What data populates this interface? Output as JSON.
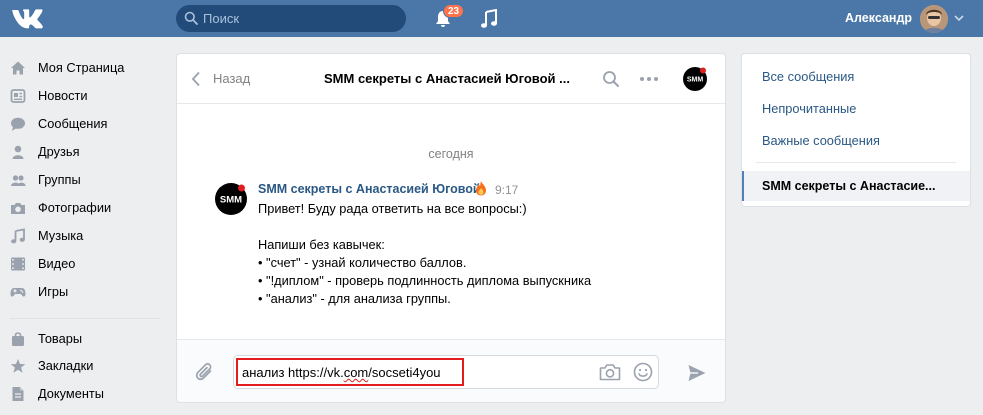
{
  "header": {
    "search_placeholder": "Поиск",
    "notification_count": "23",
    "user_name": "Александр"
  },
  "sidebar": {
    "items": [
      {
        "label": "Моя Страница",
        "icon": "home-icon"
      },
      {
        "label": "Новости",
        "icon": "news-icon"
      },
      {
        "label": "Сообщения",
        "icon": "messages-icon"
      },
      {
        "label": "Друзья",
        "icon": "friend-icon"
      },
      {
        "label": "Группы",
        "icon": "groups-icon"
      },
      {
        "label": "Фотографии",
        "icon": "camera-icon"
      },
      {
        "label": "Музыка",
        "icon": "music-note-icon"
      },
      {
        "label": "Видео",
        "icon": "video-icon"
      },
      {
        "label": "Игры",
        "icon": "gamepad-icon"
      },
      {
        "label": "Товары",
        "icon": "shopping-bag-icon"
      },
      {
        "label": "Закладки",
        "icon": "star-icon"
      },
      {
        "label": "Документы",
        "icon": "document-icon"
      }
    ]
  },
  "chat": {
    "back_label": "Назад",
    "title": "SMM секреты с Анастасией Юговой ...",
    "date_separator": "сегодня",
    "message": {
      "author": "SMM секреты с Анастасией Юговой",
      "time": "9:17",
      "lines": [
        "Привет! Буду рада ответить на все вопросы:)",
        "",
        "Напиши без кавычек:",
        "• \"счет\" - узнай количество баллов.",
        "• \"!диплом\" - проверь подлинность диплома выпускника",
        "• \"анализ\" - для анализа группы."
      ]
    },
    "composer": {
      "text_prefix": "анализ https://vk.",
      "text_underlined": "com",
      "text_suffix": "/socseti4you"
    }
  },
  "filters": {
    "items": [
      "Все сообщения",
      "Непрочитанные",
      "Важные сообщения"
    ],
    "active_chat": "SMM секреты с Анастасие..."
  },
  "colors": {
    "brand": "#4a76a8",
    "link": "#2a5885",
    "highlight": "#e01e1e",
    "badge": "#ff734c"
  }
}
